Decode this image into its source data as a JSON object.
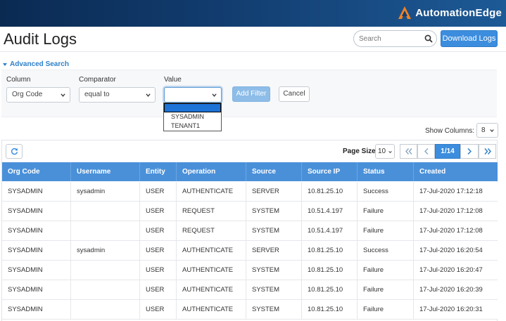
{
  "header": {
    "brand": "AutomationEdge",
    "brand_color": "#f58220"
  },
  "page": {
    "title": "Audit Logs"
  },
  "search": {
    "placeholder": "Search"
  },
  "toolbar": {
    "download_label": "Download Logs"
  },
  "advanced_search": {
    "toggle_label": "Advanced Search",
    "column_label": "Column",
    "column_value": "Org Code",
    "comparator_label": "Comparator",
    "comparator_value": "equal to",
    "value_label": "Value",
    "value_value": "",
    "value_options": [
      "",
      "SYSADMIN",
      "TENANT1"
    ],
    "add_filter_label": "Add Filter",
    "cancel_label": "Cancel"
  },
  "grid_controls": {
    "show_columns_label": "Show Columns:",
    "show_columns_value": "8",
    "page_size_label": "Page Size",
    "page_size_value": "10",
    "page_indicator": "1/14"
  },
  "table": {
    "columns": [
      "Org Code",
      "Username",
      "Entity",
      "Operation",
      "Source",
      "Source IP",
      "Status",
      "Created"
    ],
    "rows": [
      [
        "SYSADMIN",
        "sysadmin",
        "USER",
        "AUTHENTICATE",
        "SERVER",
        "10.81.25.10",
        "Success",
        "17-Jul-2020 17:12:18"
      ],
      [
        "SYSADMIN",
        "",
        "USER",
        "REQUEST",
        "SYSTEM",
        "10.51.4.197",
        "Failure",
        "17-Jul-2020 17:12:08"
      ],
      [
        "SYSADMIN",
        "",
        "USER",
        "REQUEST",
        "SYSTEM",
        "10.51.4.197",
        "Failure",
        "17-Jul-2020 17:12:08"
      ],
      [
        "SYSADMIN",
        "sysadmin",
        "USER",
        "AUTHENTICATE",
        "SERVER",
        "10.81.25.10",
        "Success",
        "17-Jul-2020 16:20:54"
      ],
      [
        "SYSADMIN",
        "",
        "USER",
        "AUTHENTICATE",
        "SYSTEM",
        "10.81.25.10",
        "Failure",
        "17-Jul-2020 16:20:47"
      ],
      [
        "SYSADMIN",
        "",
        "USER",
        "AUTHENTICATE",
        "SYSTEM",
        "10.81.25.10",
        "Failure",
        "17-Jul-2020 16:20:39"
      ],
      [
        "SYSADMIN",
        "",
        "USER",
        "AUTHENTICATE",
        "SYSTEM",
        "10.81.25.10",
        "Failure",
        "17-Jul-2020 16:20:31"
      ]
    ]
  }
}
